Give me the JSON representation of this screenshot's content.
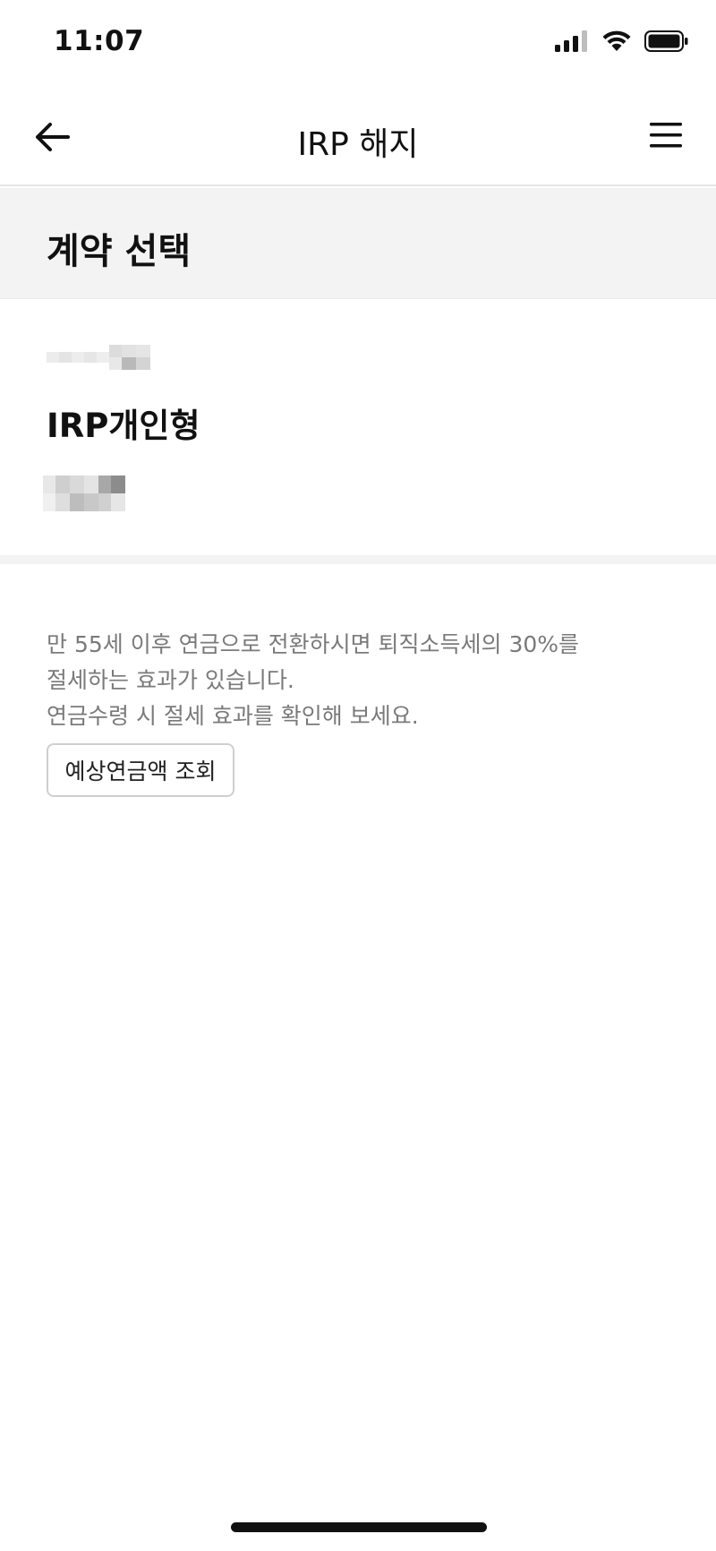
{
  "status_bar": {
    "time": "11:07",
    "icons": [
      "cellular-signal-icon",
      "wifi-icon",
      "battery-icon"
    ]
  },
  "nav": {
    "title": "IRP 해지",
    "back_icon": "arrow-left-icon",
    "menu_icon": "hamburger-menu-icon"
  },
  "section": {
    "title": "계약 선택"
  },
  "contract": {
    "name": "IRP개인형"
  },
  "info": {
    "lines": [
      "만 55세 이후 연금으로 전환하시면 퇴직소득세의 30%를",
      "절세하는 효과가 있습니다.",
      "연금수령 시 절세 효과를 확인해 보세요."
    ]
  },
  "pension_button": {
    "label": "예상연금액 조회"
  },
  "colors": {
    "text_primary": "#111111",
    "text_secondary": "#7a7a7a",
    "section_bg": "#f3f3f3",
    "border": "#cfcfcf"
  }
}
